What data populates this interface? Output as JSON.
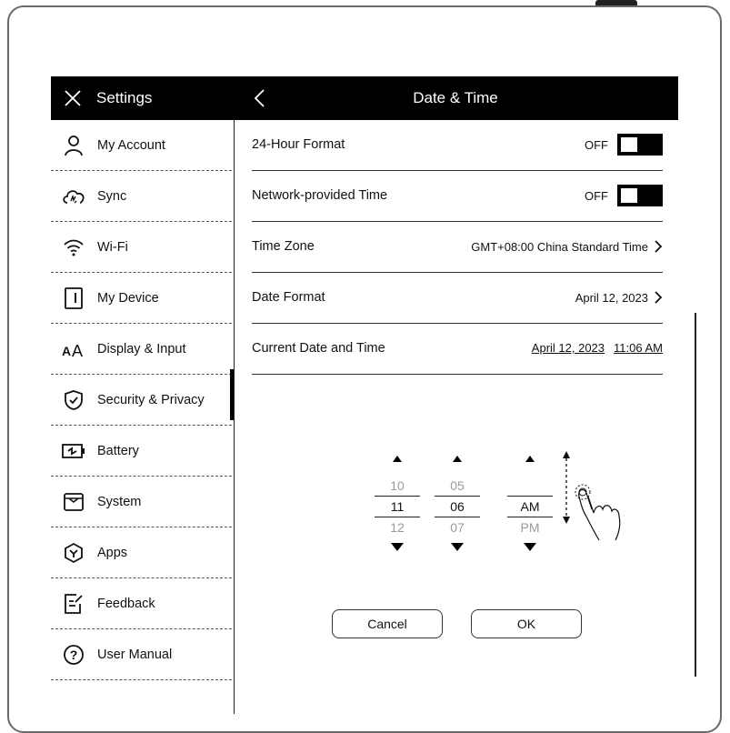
{
  "header": {
    "settings_title": "Settings",
    "page_title": "Date & Time"
  },
  "sidebar": {
    "items": [
      {
        "label": "My Account",
        "icon": "person-icon"
      },
      {
        "label": "Sync",
        "icon": "cloud-sync-icon"
      },
      {
        "label": "Wi-Fi",
        "icon": "wifi-icon"
      },
      {
        "label": "My Device",
        "icon": "device-icon"
      },
      {
        "label": "Display & Input",
        "icon": "text-size-icon"
      },
      {
        "label": "Security & Privacy",
        "icon": "shield-check-icon"
      },
      {
        "label": "Battery",
        "icon": "battery-icon"
      },
      {
        "label": "System",
        "icon": "system-icon"
      },
      {
        "label": "Apps",
        "icon": "apps-icon"
      },
      {
        "label": "Feedback",
        "icon": "feedback-icon"
      },
      {
        "label": "User Manual",
        "icon": "help-icon"
      }
    ],
    "active": "Display & Input"
  },
  "settings": {
    "hour_format": {
      "label": "24-Hour Format",
      "state": "OFF"
    },
    "network_time": {
      "label": "Network-provided Time",
      "state": "OFF"
    },
    "time_zone": {
      "label": "Time Zone",
      "value": "GMT+08:00 China Standard Time"
    },
    "date_format": {
      "label": "Date Format",
      "value": "April 12, 2023"
    },
    "current": {
      "label": "Current Date and Time",
      "date": "April 12, 2023",
      "time": "11:06 AM"
    }
  },
  "picker": {
    "hour": {
      "prev": "10",
      "selected": "11",
      "next": "12"
    },
    "minute": {
      "prev": "05",
      "selected": "06",
      "next": "07"
    },
    "ampm": {
      "prev": "",
      "selected": "AM",
      "next": "PM"
    }
  },
  "buttons": {
    "cancel": "Cancel",
    "ok": "OK"
  }
}
